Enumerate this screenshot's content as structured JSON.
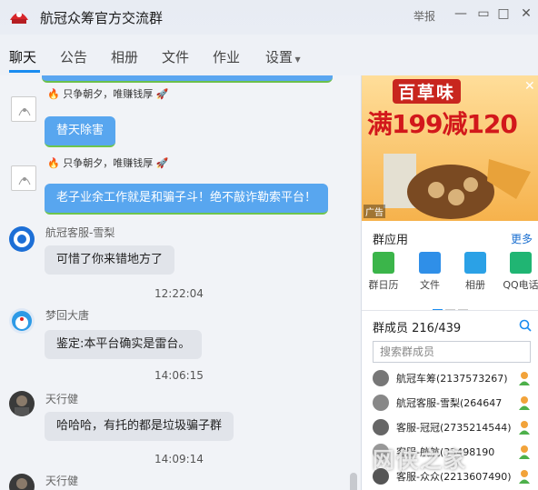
{
  "window": {
    "title": "航冠众筹官方交流群",
    "report_label": "举报",
    "controls": [
      "minimize",
      "maximize",
      "close"
    ]
  },
  "tabs": [
    {
      "label": "聊天",
      "active": true
    },
    {
      "label": "公告",
      "active": false
    },
    {
      "label": "相册",
      "active": false
    },
    {
      "label": "文件",
      "active": false
    },
    {
      "label": "作业",
      "active": false
    },
    {
      "label": "设置",
      "active": false
    }
  ],
  "messages": [
    {
      "tag": "只争朝夕，唯赚钱厚",
      "text": "替天除害",
      "style": "blue"
    },
    {
      "tag": "只争朝夕，唯赚钱厚",
      "text": "老子业余工作就是和骗子斗！绝不敲诈勒索平台！",
      "style": "blue"
    },
    {
      "nick": "航冠客服-雪梨",
      "text": "可惜了你来错地方了",
      "style": "gray"
    },
    {
      "time": "12:22:04"
    },
    {
      "nick": "梦回大唐",
      "text": "鉴定:本平台确实是雷台。",
      "style": "gray"
    },
    {
      "time": "14:06:15"
    },
    {
      "nick": "天行健",
      "text": "哈哈哈，有托的都是垃圾骗子群",
      "style": "gray"
    },
    {
      "time": "14:09:14"
    },
    {
      "nick": "天行健"
    }
  ],
  "ad": {
    "brand": "百草味",
    "promo": "满199减120",
    "tag": "广告"
  },
  "group_apps": {
    "title": "群应用",
    "more": "更多",
    "items": [
      {
        "label": "群日历",
        "icon": "calendar-icon",
        "color": "#3bb54a"
      },
      {
        "label": "文件",
        "icon": "file-icon",
        "color": "#2f8fe8"
      },
      {
        "label": "相册",
        "icon": "photo-icon",
        "color": "#2ba1e6"
      },
      {
        "label": "QQ电话",
        "icon": "phone-icon",
        "color": "#20b573"
      }
    ]
  },
  "members": {
    "title": "群成员 216/439",
    "search_placeholder": "搜索群成员",
    "list": [
      {
        "name": "航冠车筹(2137573267)"
      },
      {
        "name": "航冠客服-雪梨(264647"
      },
      {
        "name": "客服-冠冠(2735214544)"
      },
      {
        "name": "客服-航航(33498190"
      },
      {
        "name": "客服-众众(2213607490)"
      }
    ]
  },
  "watermark": "网侠之家"
}
